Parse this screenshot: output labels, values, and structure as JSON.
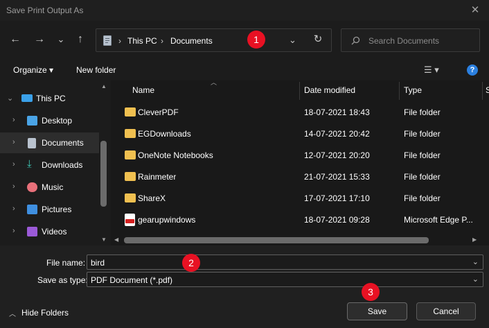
{
  "window": {
    "title": "Save Print Output As",
    "close_glyph": "✕"
  },
  "nav": {
    "back": "←",
    "forward": "→",
    "recent": "⌄",
    "up": "↑"
  },
  "address": {
    "crumbs": [
      "This PC",
      "Documents"
    ],
    "separator": "›",
    "dropdown": "⌄",
    "refresh": "↻"
  },
  "search": {
    "placeholder": "Search Documents",
    "icon": "search-icon"
  },
  "commands": {
    "organize": "Organize ▾",
    "new_folder": "New folder",
    "view": "☰ ▾",
    "help": "?"
  },
  "sidebar": {
    "items": [
      {
        "label": "This PC",
        "icon": "computer-icon",
        "expanded": true
      },
      {
        "label": "Desktop",
        "icon": "desktop-icon"
      },
      {
        "label": "Documents",
        "icon": "documents-icon",
        "selected": true
      },
      {
        "label": "Downloads",
        "icon": "downloads-icon"
      },
      {
        "label": "Music",
        "icon": "music-icon"
      },
      {
        "label": "Pictures",
        "icon": "pictures-icon"
      },
      {
        "label": "Videos",
        "icon": "videos-icon"
      }
    ]
  },
  "files": {
    "columns": [
      "Name",
      "Date modified",
      "Type",
      "S"
    ],
    "rows": [
      {
        "name": "CleverPDF",
        "date": "18-07-2021 18:43",
        "type": "File folder",
        "icon": "folder-icon"
      },
      {
        "name": "EGDownloads",
        "date": "14-07-2021 20:42",
        "type": "File folder",
        "icon": "folder-icon"
      },
      {
        "name": "OneNote Notebooks",
        "date": "12-07-2021 20:20",
        "type": "File folder",
        "icon": "folder-icon"
      },
      {
        "name": "Rainmeter",
        "date": "21-07-2021 15:33",
        "type": "File folder",
        "icon": "folder-icon"
      },
      {
        "name": "ShareX",
        "date": "17-07-2021 17:10",
        "type": "File folder",
        "icon": "folder-icon"
      },
      {
        "name": "gearupwindows",
        "date": "18-07-2021 09:28",
        "type": "Microsoft Edge P...",
        "icon": "pdf-file-icon"
      }
    ]
  },
  "form": {
    "file_name_label": "File name:",
    "file_name_value": "bird",
    "save_type_label": "Save as type:",
    "save_type_value": "PDF Document (*.pdf)"
  },
  "footer": {
    "hide_folders": "Hide Folders",
    "save": "Save",
    "cancel": "Cancel"
  },
  "annotations": [
    "1",
    "2",
    "3"
  ],
  "colors": {
    "badge": "#e81123",
    "folder": "#f0c050",
    "background": "#202020"
  }
}
